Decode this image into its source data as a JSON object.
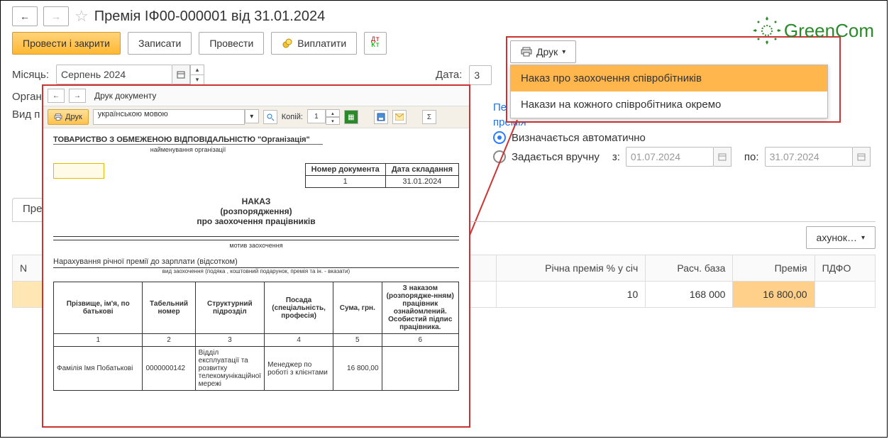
{
  "header": {
    "title": "Премія ІФ00-000001 від 31.01.2024"
  },
  "actions": {
    "post_close": "Провести і закрити",
    "write": "Записати",
    "post": "Провести",
    "pay": "Виплатити",
    "print": "Друк"
  },
  "fields": {
    "month_label": "Місяць:",
    "month_value": "Серпень 2024",
    "org_label": "Організація",
    "type_label": "Вид п",
    "date_label": "Дата:",
    "date_value": "3"
  },
  "right": {
    "period_link": "Період",
    "premia_link": "премія",
    "auto": "Визначається автоматично",
    "manual": "Задається вручну",
    "from_label": "з:",
    "from_value": "01.07.2024",
    "to_label": "по:",
    "to_value": "31.07.2024"
  },
  "print_menu": {
    "item1": "Наказ про заохочення співробітників",
    "item2": "Накази на кожного співробітника окремо"
  },
  "tabs": {
    "t1": "Пре"
  },
  "under_tabs": {
    "calc_btn": "ахунок…"
  },
  "table": {
    "headers": {
      "n": "N",
      "annual": "Річна премія % у січ",
      "base": "Расч. база",
      "premia": "Премія",
      "pdfo": "ПДФО"
    },
    "row": {
      "annual": "10",
      "base": "168 000",
      "premia": "16 800,00"
    }
  },
  "logo": {
    "text": "GreenCom"
  },
  "preview": {
    "win_title": "Друк документу",
    "print_btn": "Друк",
    "lang": "українською мовою",
    "copies_label": "Копій:",
    "copies_value": "1",
    "org": "ТОВАРИСТВО З ОБМЕЖЕНОЮ ВІДПОВІДАЛЬНІСТЮ \"Організація\"",
    "org_sub": "найменування організації",
    "doc_no_h": "Номер документа",
    "doc_date_h": "Дата складання",
    "doc_no": "1",
    "doc_date": "31.01.2024",
    "nakaz": "НАКАЗ",
    "nakaz2": "(розпорядження)",
    "nakaz3": "про заохочення працівників",
    "motiv_sub": "мотив заохочення",
    "accr_title": "Нарахування річної премії до зарплати (відсотком)",
    "accr_sub": "вид заохочення (подяка , коштовний подарунок, премія та ін. - вказати)",
    "emp_headers": {
      "h1": "Прізвище, ім'я, по батькові",
      "h2": "Табельний номер",
      "h3": "Структурний підрозділ",
      "h4": "Посада (спеціальність, професія)",
      "h5": "Сума, грн.",
      "h6": "З наказом (розпорядже-нням) працівник ознайомлений. Особистий підпис працівника."
    },
    "emp_nums": {
      "c1": "1",
      "c2": "2",
      "c3": "3",
      "c4": "4",
      "c5": "5",
      "c6": "6"
    },
    "emp_row": {
      "name": "Фамілія Імя Побатькові",
      "tab": "0000000142",
      "dept": "Відділ експлуатації та розвитку телекомунікаційної мережі",
      "pos": "Менеджер по роботі з клієнтами",
      "sum": "16 800,00",
      "sign": ""
    }
  }
}
